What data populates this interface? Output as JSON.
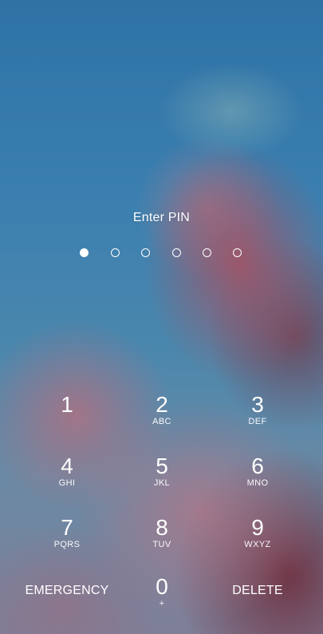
{
  "lock_screen": {
    "title": "Enter PIN",
    "pin_length": 6,
    "pin_entered": 1
  },
  "keypad": {
    "keys": [
      {
        "digit": "1",
        "letters": ""
      },
      {
        "digit": "2",
        "letters": "ABC"
      },
      {
        "digit": "3",
        "letters": "DEF"
      },
      {
        "digit": "4",
        "letters": "GHI"
      },
      {
        "digit": "5",
        "letters": "JKL"
      },
      {
        "digit": "6",
        "letters": "MNO"
      },
      {
        "digit": "7",
        "letters": "PQRS"
      },
      {
        "digit": "8",
        "letters": "TUV"
      },
      {
        "digit": "9",
        "letters": "WXYZ"
      },
      {
        "digit": "0",
        "letters": "+"
      }
    ],
    "emergency_label": "EMERGENCY",
    "delete_label": "DELETE"
  }
}
